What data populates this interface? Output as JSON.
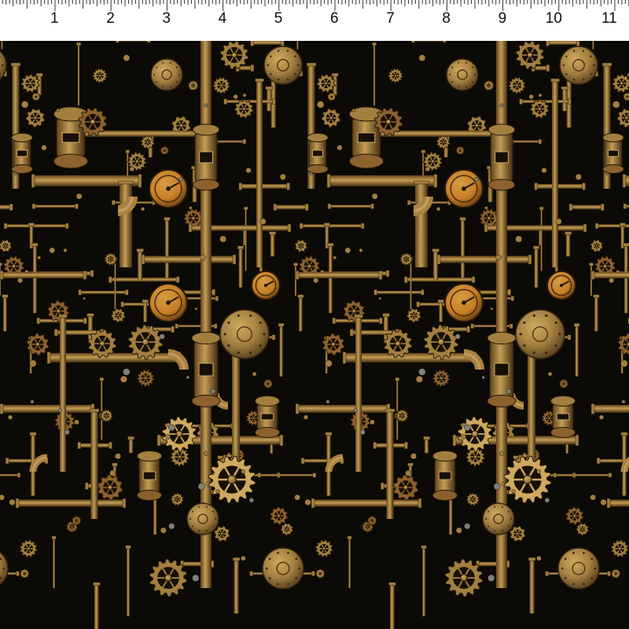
{
  "ruler": {
    "numbers": [
      "1",
      "2",
      "3",
      "4",
      "5",
      "6",
      "7",
      "8",
      "9",
      "10",
      "11"
    ]
  },
  "fabric": {
    "motif": "steampunk pipes and gears",
    "colors": {
      "background": "#0e0b07",
      "brass": "#b08a45",
      "brass_light": "#e0b868",
      "copper": "#9a6a32",
      "bronze_dark": "#5a4020",
      "orange_dial": "#d98a2a"
    }
  }
}
